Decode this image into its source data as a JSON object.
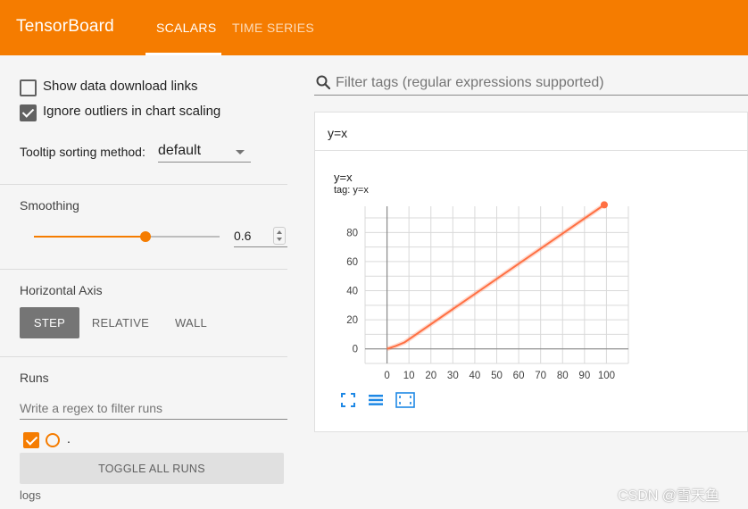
{
  "app": {
    "title": "TensorBoard",
    "tabs": [
      {
        "label": "SCALARS",
        "active": true
      },
      {
        "label": "TIME SERIES",
        "active": false
      }
    ],
    "accent_color": "#f57c00"
  },
  "sidebar": {
    "show_download_links": {
      "label": "Show data download links",
      "checked": false
    },
    "ignore_outliers": {
      "label": "Ignore outliers in chart scaling",
      "checked": true
    },
    "tooltip_sort": {
      "label": "Tooltip sorting method:",
      "value": "default"
    },
    "smoothing": {
      "label": "Smoothing",
      "value": 0.6,
      "value_text": "0.6"
    },
    "horizontal_axis": {
      "label": "Horizontal Axis",
      "options": [
        "STEP",
        "RELATIVE",
        "WALL"
      ],
      "selected": "STEP"
    },
    "runs": {
      "label": "Runs",
      "filter_placeholder": "Write a regex to filter runs",
      "items": [
        {
          "name": ".",
          "checked": true,
          "color": "#f57c00"
        }
      ],
      "toggle_all_label": "TOGGLE ALL RUNS",
      "logdir": "logs"
    }
  },
  "main": {
    "filter_placeholder": "Filter tags (regular expressions supported)",
    "card_title": "y=x",
    "chart": {
      "title": "y=x",
      "tag": "tag: y=x",
      "controls": [
        "fullscreen-icon",
        "toggle-log-scale-icon",
        "fit-domain-icon"
      ]
    }
  },
  "watermark": "CSDN @雪天鱼",
  "chart_data": {
    "type": "line",
    "title": "y=x",
    "subtitle": "tag: y=x",
    "xlabel": "",
    "ylabel": "",
    "xlim": [
      -10,
      110
    ],
    "ylim": [
      -10,
      98
    ],
    "x_ticks": [
      0,
      10,
      20,
      30,
      40,
      50,
      60,
      70,
      80,
      90,
      100
    ],
    "y_ticks": [
      0,
      20,
      40,
      60,
      80
    ],
    "x_tick_minor": 10,
    "y_tick_minor": 10,
    "grid": true,
    "series": [
      {
        "name": ".",
        "color": "#ff7043",
        "x": [
          0,
          4,
          8,
          99
        ],
        "y": [
          0,
          2,
          4.5,
          99
        ],
        "endpoint": true
      }
    ]
  }
}
